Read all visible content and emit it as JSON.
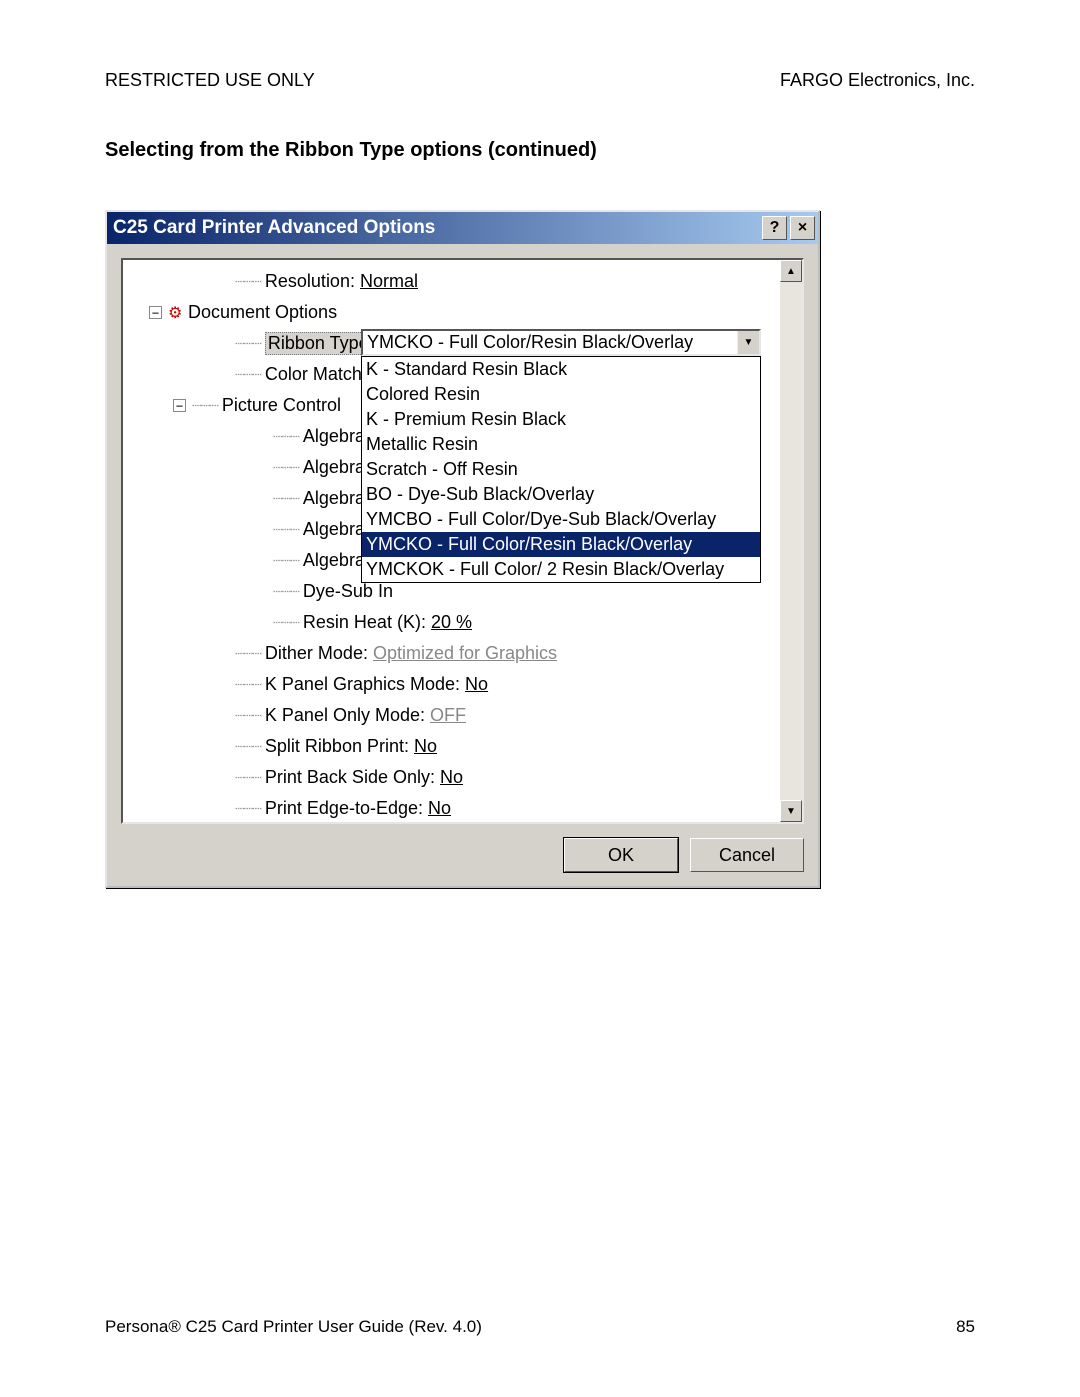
{
  "header": {
    "left": "RESTRICTED USE ONLY",
    "right": "FARGO Electronics, Inc."
  },
  "section_title": "Selecting from the Ribbon Type options (continued)",
  "dialog": {
    "title": "C25 Card Printer Advanced Options",
    "help_btn": "?",
    "close_btn": "×",
    "ok": "OK",
    "cancel": "Cancel"
  },
  "tree": {
    "resolution_label": "Resolution:",
    "resolution_value": "Normal",
    "doc_options": "Document Options",
    "ribbon_type_label": "Ribbon Type:",
    "ribbon_type_value": "YMCKO - Full Color/Resin Black/Overlay",
    "color_matching": "Color Matching",
    "picture_control": "Picture Control",
    "algebraic_c1": "Algebraic C",
    "algebraic_c2": "Algebraic C",
    "algebraic_y": "Algebraic Y",
    "algebraic_m": "Algebraic M",
    "algebraic_c3": "Algebraic C",
    "dye_sub_in": "Dye-Sub In",
    "resin_heat_label": "Resin Heat (K):",
    "resin_heat_value": "20 %",
    "dither_label": "Dither Mode:",
    "dither_value": "Optimized for Graphics",
    "kpanel_graphics_label": "K Panel Graphics Mode:",
    "kpanel_graphics_value": "No",
    "kpanel_only_label": "K Panel Only Mode:",
    "kpanel_only_value": "OFF",
    "split_ribbon_label": "Split Ribbon Print:",
    "split_ribbon_value": "No",
    "print_back_label": "Print Back Side Only:",
    "print_back_value": "No",
    "print_edge_label": "Print Edge-to-Edge:",
    "print_edge_value": "No"
  },
  "dropdown": {
    "options": [
      "K - Standard Resin Black",
      "Colored Resin",
      "K - Premium Resin Black",
      "Metallic Resin",
      "Scratch - Off Resin",
      "BO - Dye-Sub Black/Overlay",
      "YMCBO - Full Color/Dye-Sub Black/Overlay",
      "YMCKO - Full Color/Resin Black/Overlay",
      "YMCKOK - Full Color/ 2 Resin Black/Overlay"
    ],
    "highlighted_index": 7
  },
  "footer": {
    "left": "Persona® C25 Card Printer User Guide (Rev. 4.0)",
    "right": "85"
  }
}
